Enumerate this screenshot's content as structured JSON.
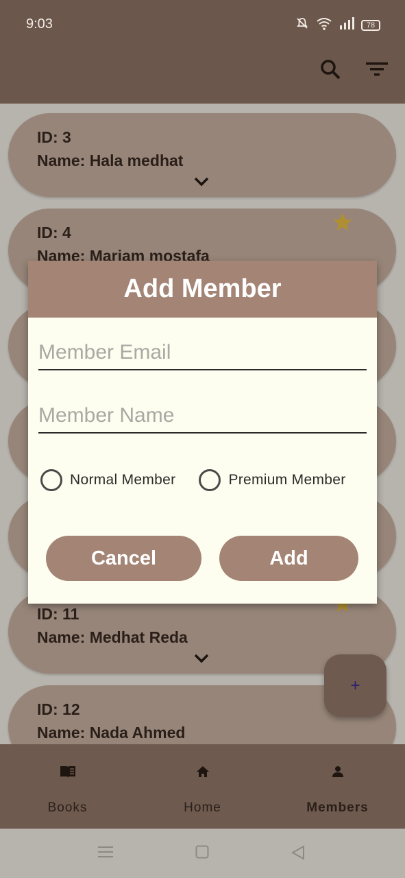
{
  "status_bar": {
    "time": "9:03",
    "battery": "78"
  },
  "appbar": {
    "icons": [
      "search-icon",
      "filter-icon"
    ]
  },
  "members": [
    {
      "id_text": "ID: 3",
      "name_text": "Name: Hala medhat",
      "premium": false
    },
    {
      "id_text": "ID: 4",
      "name_text": "Name: Mariam mostafa",
      "premium": true
    },
    {
      "id_text": "ID: 11",
      "name_text": "Name: Medhat Reda",
      "premium": true
    },
    {
      "id_text": "ID: 12",
      "name_text": "Name: Nada Ahmed",
      "premium": false
    }
  ],
  "dialog": {
    "title": "Add Member",
    "email_placeholder": "Member Email",
    "name_placeholder": "Member Name",
    "radio_normal": "Normal Member",
    "radio_premium": "Premium Member",
    "cancel_label": "Cancel",
    "add_label": "Add"
  },
  "fab": {
    "label": "+"
  },
  "bottom_nav": {
    "items": [
      {
        "label": "Books",
        "icon": "book-icon",
        "active": false
      },
      {
        "label": "Home",
        "icon": "home-icon",
        "active": false
      },
      {
        "label": "Members",
        "icon": "person-icon",
        "active": true
      }
    ]
  },
  "colors": {
    "app_bar": "#6b574b",
    "card": "#978579",
    "dialog_header": "#a48474",
    "dialog_bg": "#fdfeef",
    "star": "#c9a227"
  }
}
